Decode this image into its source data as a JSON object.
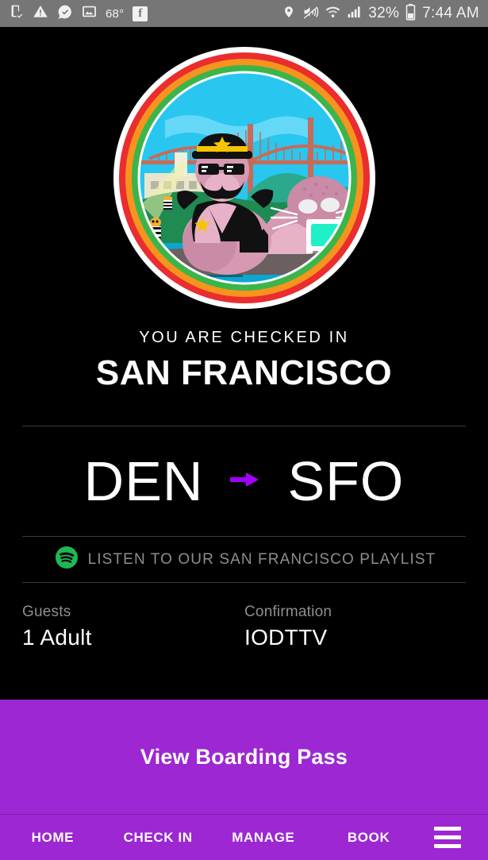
{
  "statusbar": {
    "left_icons": [
      {
        "name": "device-check-icon",
        "glyph": "device-check"
      },
      {
        "name": "warning-triangle-icon",
        "glyph": "warning"
      },
      {
        "name": "message-check-icon",
        "glyph": "message-check"
      },
      {
        "name": "image-icon",
        "glyph": "image"
      }
    ],
    "temperature": "68°",
    "facebook_letter": "f",
    "right_icons": [
      {
        "name": "location-pin-icon",
        "glyph": "pin"
      },
      {
        "name": "volume-mute-vibrate-icon",
        "glyph": "mute"
      },
      {
        "name": "wifi-icon",
        "glyph": "wifi"
      },
      {
        "name": "cell-signal-icon",
        "glyph": "signal"
      }
    ],
    "battery_percent": "32%",
    "clock": "7:44 AM"
  },
  "hero": {
    "badge_name": "san-francisco-destination-badge",
    "badge_alt": "San Francisco illustration with rainbow, Golden Gate Bridge, Alcatraz, sea lion police officer, seal and vintage Macintosh"
  },
  "checkin": {
    "status_text": "YOU ARE CHECKED IN",
    "city": "SAN FRANCISCO"
  },
  "route": {
    "origin": "DEN",
    "destination": "SFO",
    "arrow_icon": "arrow-right-icon"
  },
  "spotify": {
    "icon": "spotify-icon",
    "label": "LISTEN TO OUR SAN FRANCISCO PLAYLIST"
  },
  "details": {
    "guests_label": "Guests",
    "guests_value": "1 Adult",
    "confirmation_label": "Confirmation",
    "confirmation_value": "IODTTV"
  },
  "cta": {
    "label": "View Boarding Pass"
  },
  "nav": {
    "items": [
      {
        "label": "HOME",
        "name": "nav-item-home"
      },
      {
        "label": "CHECK IN",
        "name": "nav-item-check-in"
      },
      {
        "label": "MANAGE",
        "name": "nav-item-manage"
      },
      {
        "label": "BOOK",
        "name": "nav-item-book"
      }
    ],
    "menu_icon": "hamburger-menu-icon"
  },
  "colors": {
    "accent_purple": "#9c27d3",
    "spotify_green": "#1DB954",
    "background": "#000000",
    "statusbar": "#767676",
    "divider": "#3a3a3a"
  }
}
